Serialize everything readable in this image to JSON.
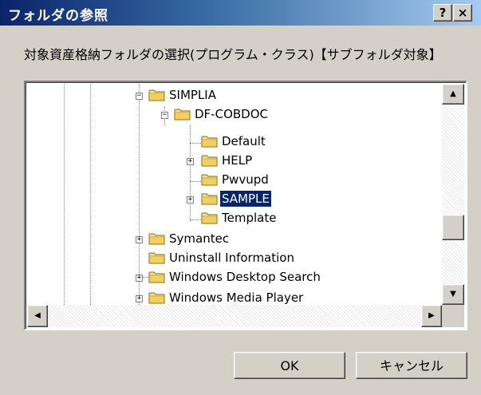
{
  "window": {
    "title": "フォルダの参照",
    "help_label": "?",
    "close_label": "×"
  },
  "description": "対象資産格納フォルダの選択(プログラム・クラス)【サブフォルダ対象】",
  "tree": {
    "items": [
      {
        "label": "SIMPLIA",
        "level": 0,
        "expander": "−"
      },
      {
        "label": "DF-COBDOC",
        "level": 1,
        "expander": "−"
      },
      {
        "label": "Default",
        "level": 2,
        "expander": ""
      },
      {
        "label": "HELP",
        "level": 2,
        "expander": "+"
      },
      {
        "label": "Pwvupd",
        "level": 2,
        "expander": ""
      },
      {
        "label": "SAMPLE",
        "level": 2,
        "expander": "+",
        "selected": true
      },
      {
        "label": "Template",
        "level": 2,
        "expander": ""
      },
      {
        "label": "Symantec",
        "level": 0,
        "expander": "+"
      },
      {
        "label": "Uninstall Information",
        "level": 0,
        "expander": ""
      },
      {
        "label": "Windows Desktop Search",
        "level": 0,
        "expander": "+"
      },
      {
        "label": "Windows Media Player",
        "level": 0,
        "expander": "+"
      }
    ]
  },
  "scrollbars": {
    "up_arrow": "▲",
    "down_arrow": "▼",
    "left_arrow": "◀",
    "right_arrow": "▶"
  },
  "buttons": {
    "ok_label": "OK",
    "cancel_label": "キャンセル"
  },
  "colors": {
    "title_start": "#0a246a",
    "title_end": "#a6caf0",
    "folder": "#f0d060",
    "selection": "#0a246a",
    "face": "#d4d0c8"
  }
}
